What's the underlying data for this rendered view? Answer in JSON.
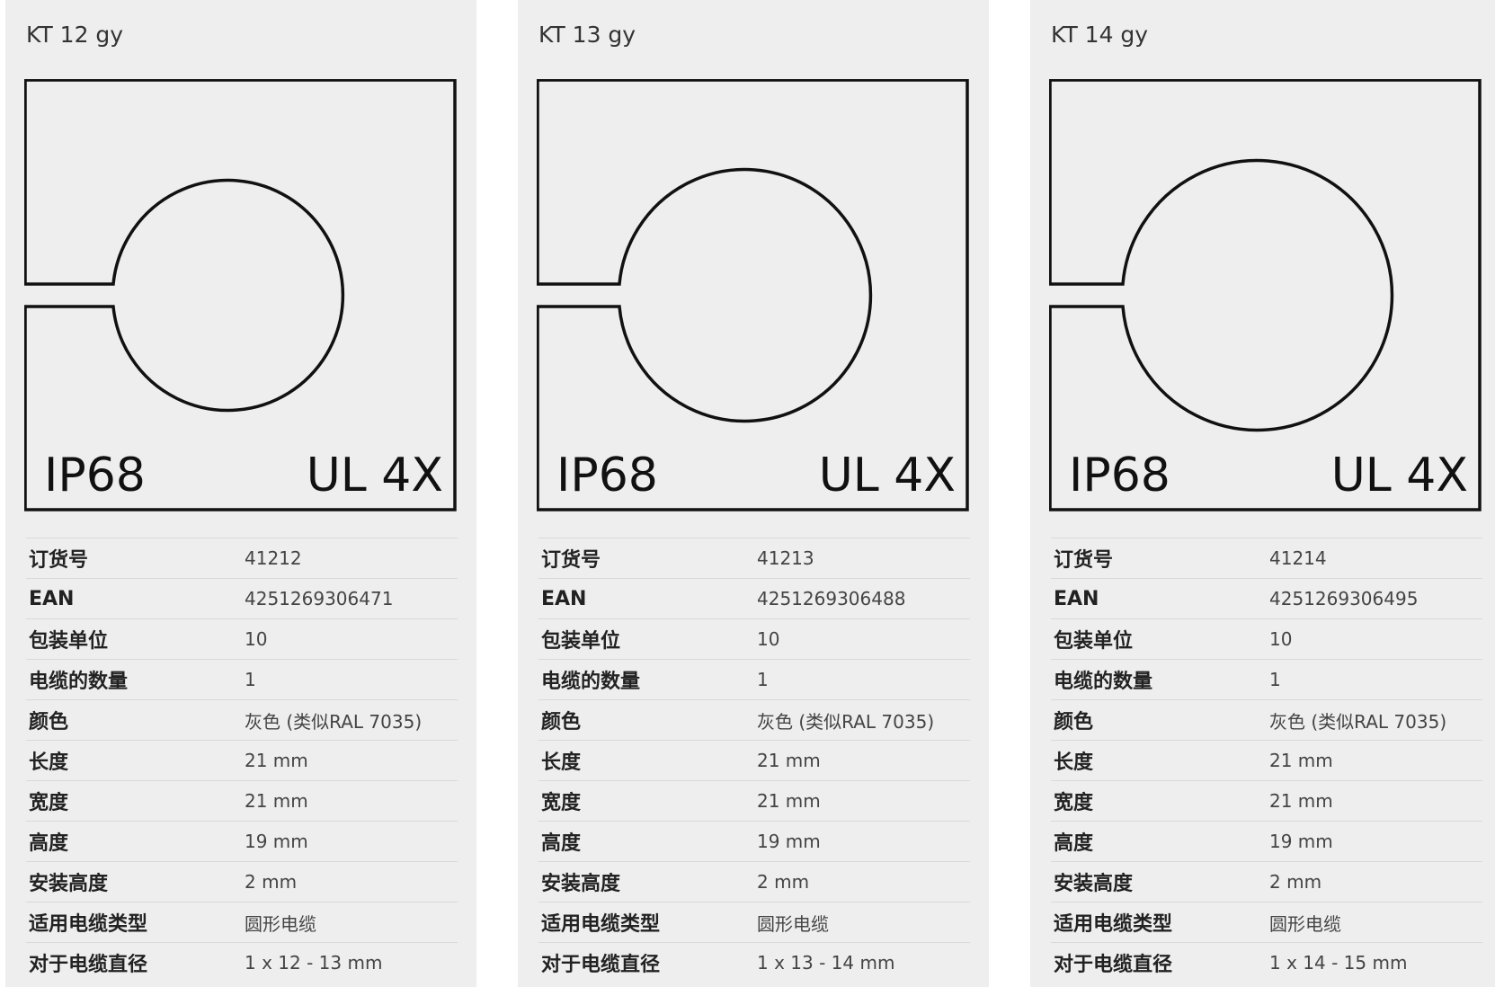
{
  "colors": {
    "page_background": "#ffffff",
    "card_background": "#eeeeee",
    "diagram_stroke": "#111111",
    "row_divider": "#d9d9d9"
  },
  "products": [
    {
      "title": "KT 12 gy",
      "diagram": {
        "left_label": "IP68",
        "right_label": "UL 4X"
      },
      "specs": [
        {
          "label": "订货号",
          "value": "41212"
        },
        {
          "label": "EAN",
          "value": "4251269306471"
        },
        {
          "label": "包装单位",
          "value": "10"
        },
        {
          "label": "电缆的数量",
          "value": "1"
        },
        {
          "label": "颜色",
          "value": "灰色 (类似RAL 7035)"
        },
        {
          "label": "长度",
          "value": "21 mm"
        },
        {
          "label": "宽度",
          "value": "21 mm"
        },
        {
          "label": "高度",
          "value": "19 mm"
        },
        {
          "label": "安装高度",
          "value": "2 mm"
        },
        {
          "label": "适用电缆类型",
          "value": "圆形电缆"
        },
        {
          "label": "对于电缆直径",
          "value": "1 x 12 - 13 mm"
        }
      ]
    },
    {
      "title": "KT 13 gy",
      "diagram": {
        "left_label": "IP68",
        "right_label": "UL 4X"
      },
      "specs": [
        {
          "label": "订货号",
          "value": "41213"
        },
        {
          "label": "EAN",
          "value": "4251269306488"
        },
        {
          "label": "包装单位",
          "value": "10"
        },
        {
          "label": "电缆的数量",
          "value": "1"
        },
        {
          "label": "颜色",
          "value": "灰色 (类似RAL 7035)"
        },
        {
          "label": "长度",
          "value": "21 mm"
        },
        {
          "label": "宽度",
          "value": "21 mm"
        },
        {
          "label": "高度",
          "value": "19 mm"
        },
        {
          "label": "安装高度",
          "value": "2 mm"
        },
        {
          "label": "适用电缆类型",
          "value": "圆形电缆"
        },
        {
          "label": "对于电缆直径",
          "value": "1 x 13 - 14 mm"
        }
      ]
    },
    {
      "title": "KT 14 gy",
      "diagram": {
        "left_label": "IP68",
        "right_label": "UL 4X"
      },
      "specs": [
        {
          "label": "订货号",
          "value": "41214"
        },
        {
          "label": "EAN",
          "value": "4251269306495"
        },
        {
          "label": "包装单位",
          "value": "10"
        },
        {
          "label": "电缆的数量",
          "value": "1"
        },
        {
          "label": "颜色",
          "value": "灰色 (类似RAL 7035)"
        },
        {
          "label": "长度",
          "value": "21 mm"
        },
        {
          "label": "宽度",
          "value": "21 mm"
        },
        {
          "label": "高度",
          "value": "19 mm"
        },
        {
          "label": "安装高度",
          "value": "2 mm"
        },
        {
          "label": "适用电缆类型",
          "value": "圆形电缆"
        },
        {
          "label": "对于电缆直径",
          "value": "1 x 14 - 15 mm"
        }
      ]
    }
  ]
}
